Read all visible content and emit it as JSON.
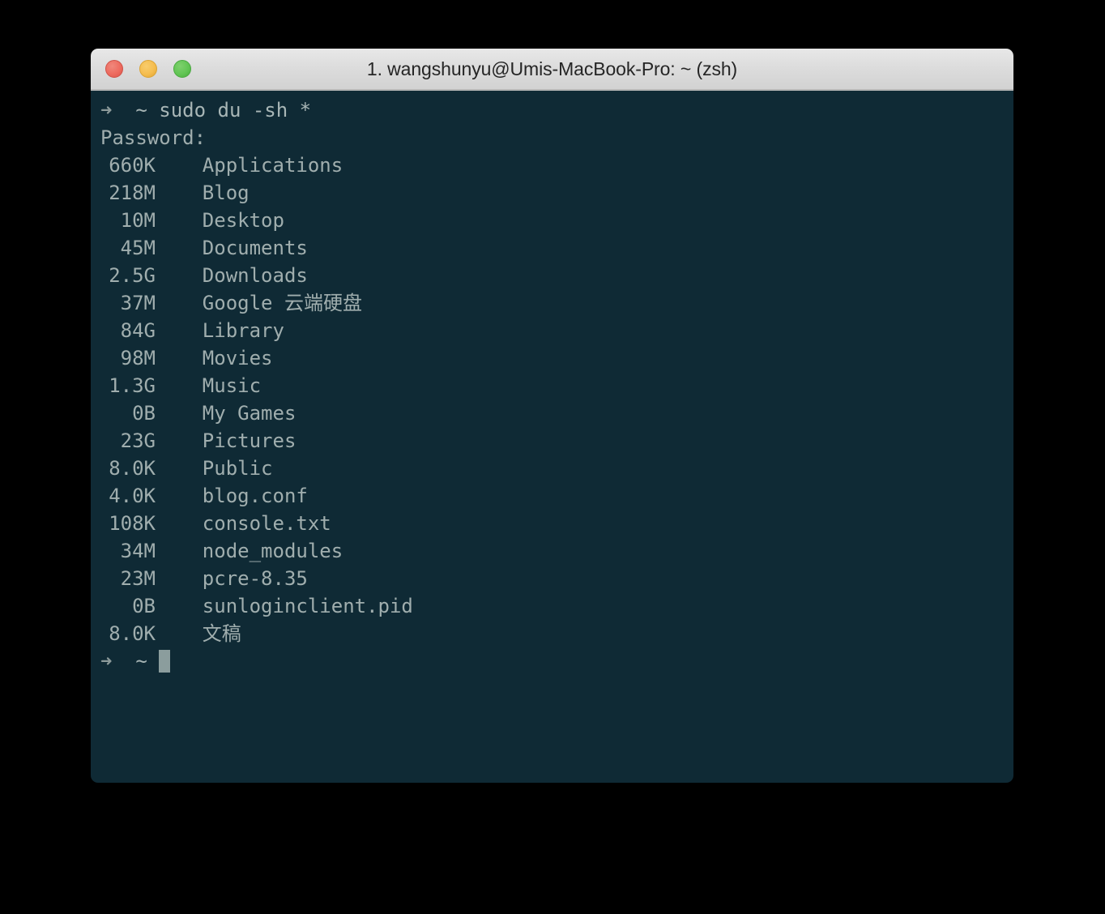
{
  "window": {
    "title": "1. wangshunyu@Umis-MacBook-Pro: ~ (zsh)",
    "traffic_lights": {
      "close_label": "close",
      "minimize_label": "minimize",
      "zoom_label": "zoom"
    },
    "colors": {
      "terminal_background": "#0f2a35",
      "terminal_foreground": "#a0aeae",
      "titlebar_background": "#dcdcdc",
      "titlebar_text": "#252525",
      "close_button": "#ed6b5f",
      "minimize_button": "#f5bd4f",
      "zoom_button": "#62c554",
      "cursor": "#8b9d9d"
    }
  },
  "terminal": {
    "prompt_symbol": "➜",
    "prompt_path": "~",
    "command": "sudo du -sh *",
    "password_prompt": "Password:",
    "entries": [
      {
        "size": "660K",
        "name": "Applications"
      },
      {
        "size": "218M",
        "name": "Blog"
      },
      {
        "size": "10M",
        "name": "Desktop"
      },
      {
        "size": "45M",
        "name": "Documents"
      },
      {
        "size": "2.5G",
        "name": "Downloads"
      },
      {
        "size": "37M",
        "name": "Google 云端硬盘"
      },
      {
        "size": "84G",
        "name": "Library"
      },
      {
        "size": "98M",
        "name": "Movies"
      },
      {
        "size": "1.3G",
        "name": "Music"
      },
      {
        "size": "0B",
        "name": "My Games"
      },
      {
        "size": "23G",
        "name": "Pictures"
      },
      {
        "size": "8.0K",
        "name": "Public"
      },
      {
        "size": "4.0K",
        "name": "blog.conf"
      },
      {
        "size": "108K",
        "name": "console.txt"
      },
      {
        "size": "34M",
        "name": "node_modules"
      },
      {
        "size": "23M",
        "name": "pcre-8.35"
      },
      {
        "size": "0B",
        "name": "sunloginclient.pid"
      },
      {
        "size": "8.0K",
        "name": "文稿"
      }
    ],
    "final_prompt": {
      "symbol": "➜",
      "path": "~"
    }
  }
}
